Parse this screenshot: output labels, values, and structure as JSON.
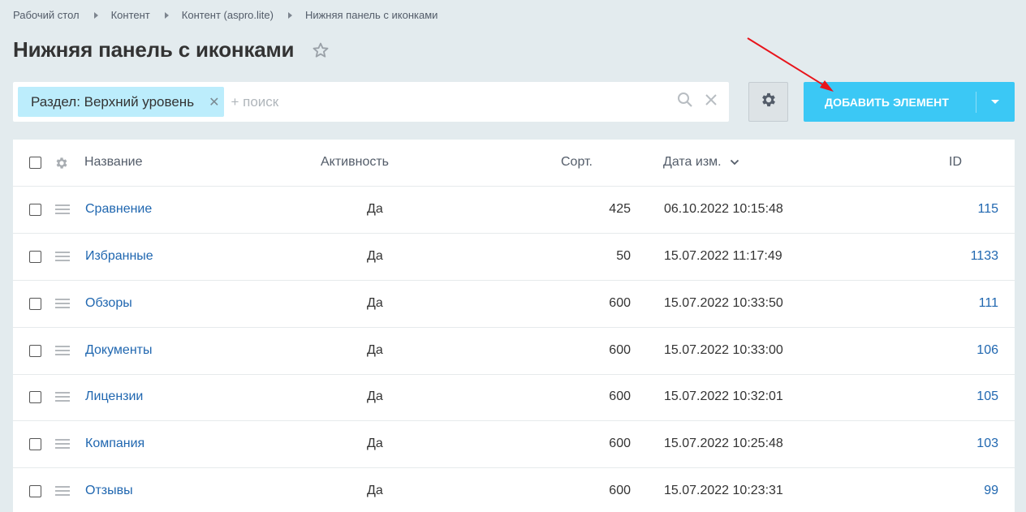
{
  "breadcrumb": [
    "Рабочий стол",
    "Контент",
    "Контент (aspro.lite)",
    "Нижняя панель с иконками"
  ],
  "page_title": "Нижняя панель с иконками",
  "filter": {
    "tag_label": "Раздел: Верхний уровень",
    "search_placeholder": "+ поиск"
  },
  "add_button": {
    "label": "ДОБАВИТЬ ЭЛЕМЕНТ"
  },
  "table": {
    "headers": {
      "name": "Название",
      "active": "Активность",
      "sort": "Сорт.",
      "date": "Дата изм.",
      "id": "ID"
    },
    "rows": [
      {
        "name": "Сравнение",
        "active": "Да",
        "sort": "425",
        "date": "06.10.2022 10:15:48",
        "id": "115"
      },
      {
        "name": "Избранные",
        "active": "Да",
        "sort": "50",
        "date": "15.07.2022 11:17:49",
        "id": "1133"
      },
      {
        "name": "Обзоры",
        "active": "Да",
        "sort": "600",
        "date": "15.07.2022 10:33:50",
        "id": "111"
      },
      {
        "name": "Документы",
        "active": "Да",
        "sort": "600",
        "date": "15.07.2022 10:33:00",
        "id": "106"
      },
      {
        "name": "Лицензии",
        "active": "Да",
        "sort": "600",
        "date": "15.07.2022 10:32:01",
        "id": "105"
      },
      {
        "name": "Компания",
        "active": "Да",
        "sort": "600",
        "date": "15.07.2022 10:25:48",
        "id": "103"
      },
      {
        "name": "Отзывы",
        "active": "Да",
        "sort": "600",
        "date": "15.07.2022 10:23:31",
        "id": "99"
      }
    ]
  },
  "colors": {
    "accent": "#3bc8f5",
    "link": "#2067b0",
    "tag_bg": "#bcedfc",
    "annotation_arrow": "#e8141b"
  }
}
